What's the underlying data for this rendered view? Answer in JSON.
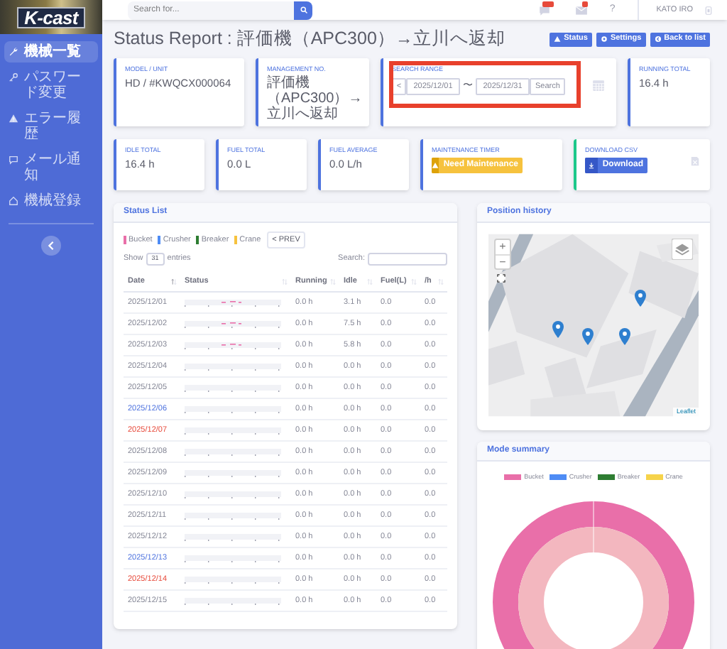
{
  "logo": {
    "text": "K-cast"
  },
  "sidebar": {
    "items": [
      {
        "label": "機械一覧",
        "selected": true
      },
      {
        "label": "パスワード変更",
        "selected": false
      },
      {
        "label": "エラー履歴",
        "selected": false
      },
      {
        "label": "メール通知",
        "selected": false
      },
      {
        "label": "機械登録",
        "selected": false
      }
    ]
  },
  "topbar": {
    "search": {
      "placeholder": "Search for..."
    },
    "help": "?",
    "user": "KATO IRO"
  },
  "page": {
    "title": "Status Report : 評価機（APC300）→立川へ返却",
    "buttons": [
      {
        "label": "Status"
      },
      {
        "label": "Settings"
      },
      {
        "label": "Back to list"
      }
    ]
  },
  "card_rows": [
    [
      {
        "kind": "value",
        "label": "MODEL / UNIT",
        "value": "HD / #KWQCX000064",
        "color": "#4e73df"
      },
      {
        "kind": "value",
        "label": "MANAGEMENT NO.",
        "value": "評価機（APC300）→立川へ返却",
        "color": "#4e73df"
      },
      {
        "kind": "range",
        "label": "SEARCH RANGE",
        "prev": "<",
        "from": "2025/12/01",
        "separator": "〜",
        "to": "2025/12/31",
        "button": "Search",
        "highlighted": true,
        "color": "#4e73df"
      },
      {
        "kind": "value",
        "label": "RUNNING TOTAL",
        "value": "16.4 h",
        "color": "#4e73df"
      }
    ],
    [
      {
        "kind": "value",
        "label": "IDLE TOTAL",
        "value": "16.4 h",
        "color": "#4e73df"
      },
      {
        "kind": "value",
        "label": "FUEL TOTAL",
        "value": "0.0 L",
        "color": "#4e73df"
      },
      {
        "kind": "value",
        "label": "FUEL AVERAGE",
        "value": "0.0 L/h",
        "color": "#4e73df"
      },
      {
        "kind": "maintenance",
        "label": "MAINTENANCE TIMER",
        "button": "Need Maintenance",
        "color": "#4e73df"
      },
      {
        "kind": "download",
        "label": "DOWNLOAD CSV",
        "button": "Download",
        "color": "#1cc88a"
      }
    ]
  ],
  "status_list": {
    "title": "Status List",
    "legend": [
      {
        "label": "Bucket",
        "color": "#e96fa9"
      },
      {
        "label": "Crusher",
        "color": "#4e8cf5"
      },
      {
        "label": "Breaker",
        "color": "#2e7d32"
      },
      {
        "label": "Crane",
        "color": "#f6c23e"
      }
    ],
    "prev_button": "< PREV",
    "show_label": "Show",
    "entries": "31",
    "entries_label": "entries",
    "search_label": "Search:",
    "columns": [
      {
        "label": "Date",
        "sorted": true
      },
      {
        "label": "Status",
        "sorted": false
      },
      {
        "label": "Running",
        "sorted": false
      },
      {
        "label": "Idle",
        "sorted": false
      },
      {
        "label": "Fuel(L)",
        "sorted": false
      },
      {
        "label": "/h",
        "sorted": false
      }
    ],
    "rows": [
      {
        "date": "2025/12/01",
        "color": "#858796",
        "activity": true,
        "running": "0.0 h",
        "idle": "3.1 h",
        "fuel": "0.0",
        "rate": "0.0"
      },
      {
        "date": "2025/12/02",
        "color": "#858796",
        "activity": true,
        "running": "0.0 h",
        "idle": "7.5 h",
        "fuel": "0.0",
        "rate": "0.0"
      },
      {
        "date": "2025/12/03",
        "color": "#858796",
        "activity": true,
        "running": "0.0 h",
        "idle": "5.8 h",
        "fuel": "0.0",
        "rate": "0.0"
      },
      {
        "date": "2025/12/04",
        "color": "#858796",
        "activity": false,
        "running": "0.0 h",
        "idle": "0.0 h",
        "fuel": "0.0",
        "rate": "0.0"
      },
      {
        "date": "2025/12/05",
        "color": "#858796",
        "activity": false,
        "running": "0.0 h",
        "idle": "0.0 h",
        "fuel": "0.0",
        "rate": "0.0"
      },
      {
        "date": "2025/12/06",
        "color": "#4e73df",
        "activity": false,
        "running": "0.0 h",
        "idle": "0.0 h",
        "fuel": "0.0",
        "rate": "0.0"
      },
      {
        "date": "2025/12/07",
        "color": "#e74a3b",
        "activity": false,
        "running": "0.0 h",
        "idle": "0.0 h",
        "fuel": "0.0",
        "rate": "0.0"
      },
      {
        "date": "2025/12/08",
        "color": "#858796",
        "activity": false,
        "running": "0.0 h",
        "idle": "0.0 h",
        "fuel": "0.0",
        "rate": "0.0"
      },
      {
        "date": "2025/12/09",
        "color": "#858796",
        "activity": false,
        "running": "0.0 h",
        "idle": "0.0 h",
        "fuel": "0.0",
        "rate": "0.0"
      },
      {
        "date": "2025/12/10",
        "color": "#858796",
        "activity": false,
        "running": "0.0 h",
        "idle": "0.0 h",
        "fuel": "0.0",
        "rate": "0.0"
      },
      {
        "date": "2025/12/11",
        "color": "#858796",
        "activity": false,
        "running": "0.0 h",
        "idle": "0.0 h",
        "fuel": "0.0",
        "rate": "0.0"
      },
      {
        "date": "2025/12/12",
        "color": "#858796",
        "activity": false,
        "running": "0.0 h",
        "idle": "0.0 h",
        "fuel": "0.0",
        "rate": "0.0"
      },
      {
        "date": "2025/12/13",
        "color": "#4e73df",
        "activity": false,
        "running": "0.0 h",
        "idle": "0.0 h",
        "fuel": "0.0",
        "rate": "0.0"
      },
      {
        "date": "2025/12/14",
        "color": "#e74a3b",
        "activity": false,
        "running": "0.0 h",
        "idle": "0.0 h",
        "fuel": "0.0",
        "rate": "0.0"
      },
      {
        "date": "2025/12/15",
        "color": "#858796",
        "activity": false,
        "running": "0.0 h",
        "idle": "0.0 h",
        "fuel": "0.0",
        "rate": "0.0"
      }
    ]
  },
  "position_history": {
    "title": "Position history",
    "zoom_in": "+",
    "zoom_out": "−",
    "attribution": "Leaflet"
  },
  "mode_summary": {
    "title": "Mode summary",
    "legend": [
      {
        "label": "Bucket",
        "color": "#e96fa9"
      },
      {
        "label": "Crusher",
        "color": "#4e8cf5"
      },
      {
        "label": "Breaker",
        "color": "#2e7d32"
      },
      {
        "label": "Crane",
        "color": "#f6d34a"
      }
    ]
  }
}
